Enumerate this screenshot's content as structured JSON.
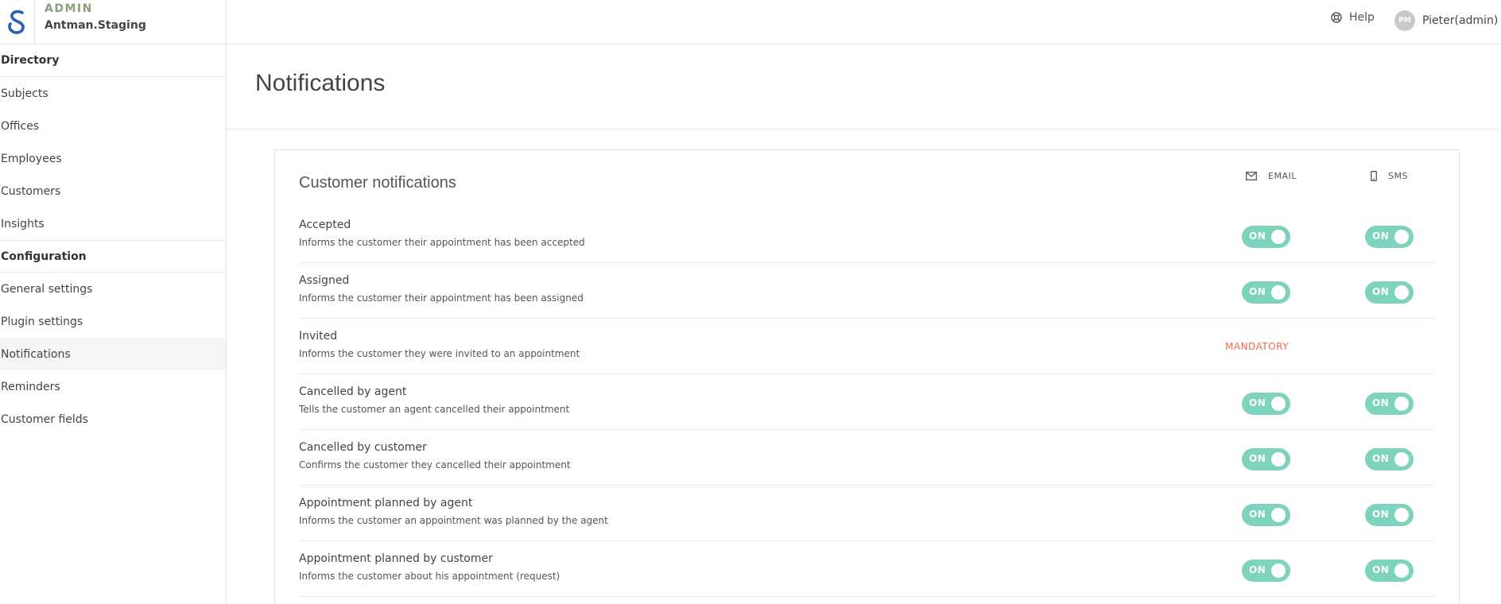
{
  "header": {
    "admin_label": "ADMIN",
    "org_name": "Antman.Staging",
    "help_label": "Help",
    "avatar_initials": "PM",
    "user_name": "Pieter(admin)"
  },
  "sidebar": {
    "directory_heading": "Directory",
    "directory_items": [
      "Subjects",
      "Offices",
      "Employees",
      "Customers",
      "Insights"
    ],
    "configuration_heading": "Configuration",
    "configuration_items": [
      "General settings",
      "Plugin settings",
      "Notifications",
      "Reminders",
      "Customer fields"
    ],
    "active_item": "Notifications"
  },
  "page": {
    "title": "Notifications"
  },
  "card": {
    "title": "Customer notifications",
    "email_col": "EMAIL",
    "sms_col": "SMS",
    "toggle_on_label": "ON",
    "mandatory_label": "MANDATORY",
    "rows": [
      {
        "title": "Accepted",
        "desc": "Informs the customer their appointment has been accepted",
        "email": "ON",
        "sms": "ON"
      },
      {
        "title": "Assigned",
        "desc": "Informs the customer their appointment has been assigned",
        "email": "ON",
        "sms": "ON"
      },
      {
        "title": "Invited",
        "desc": "Informs the customer they were invited to an appointment",
        "email": "MANDATORY",
        "sms": ""
      },
      {
        "title": "Cancelled by agent",
        "desc": "Tells the customer an agent cancelled their appointment",
        "email": "ON",
        "sms": "ON"
      },
      {
        "title": "Cancelled by customer",
        "desc": "Confirms the customer they cancelled their appointment",
        "email": "ON",
        "sms": "ON"
      },
      {
        "title": "Appointment planned by agent",
        "desc": "Informs the customer an appointment was planned by the agent",
        "email": "ON",
        "sms": "ON"
      },
      {
        "title": "Appointment planned by customer",
        "desc": "Informs the customer about his appointment (request)",
        "email": "ON",
        "sms": "ON"
      }
    ]
  },
  "colors": {
    "toggle_on": "#7ed3bd",
    "mandatory": "#f0694f",
    "brand_logo": "#2a5fb8",
    "admin_label": "#8aa07e"
  }
}
